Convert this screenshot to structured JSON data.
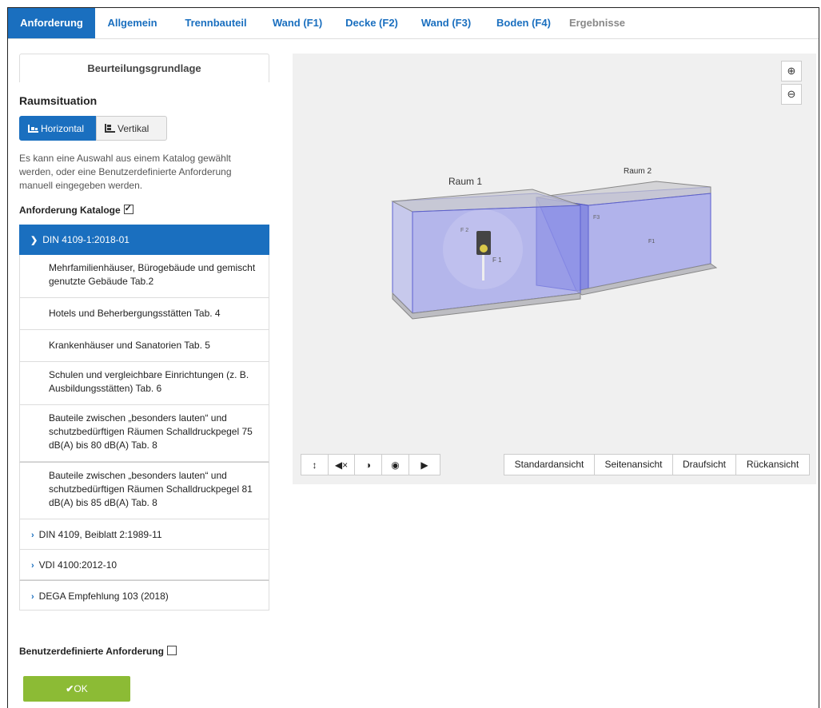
{
  "tabs": [
    {
      "label": "Anforderung"
    },
    {
      "label": "Allgemein"
    },
    {
      "label": "Trennbauteil"
    },
    {
      "label": "Wand (F1)"
    },
    {
      "label": "Decke (F2)"
    },
    {
      "label": "Wand (F3)"
    },
    {
      "label": "Boden (F4)"
    },
    {
      "label": "Ergebnisse"
    }
  ],
  "panel": {
    "title": "Beurteilungsgrundlage",
    "raumsituation": "Raumsituation",
    "toggle_horizontal": "Horizontal",
    "toggle_vertikal": "Vertikal",
    "description": "Es kann eine Auswahl aus einem Katalog gewählt werden, oder eine Benutzerdefinierte Anforderung manuell eingegeben werden.",
    "kataloge_label": "Anforderung Kataloge",
    "kataloge_checked": true,
    "accordion_open": "DIN 4109-1:2018-01",
    "items": [
      {
        "label": "Mehrfamilienhäuser, Bürogebäude und gemischt genutzte Gebäude Tab.2"
      },
      {
        "label": "Hotels und Beherbergungsstätten Tab. 4"
      },
      {
        "label": "Krankenhäuser und Sanatorien Tab. 5"
      },
      {
        "label": "Schulen und vergleichbare Einrichtungen (z. B. Ausbildungsstätten) Tab. 6"
      },
      {
        "label": "Bauteile zwischen „besonders lauten“ und schutzbedürftigen Räumen Schalldruckpegel 75 dB(A) bis 80 dB(A) Tab. 8"
      },
      {
        "label": "Bauteile zwischen „besonders lauten“ und schutzbedürftigen Räumen Schalldruckpegel 81 dB(A) bis 85 dB(A) Tab. 8"
      }
    ],
    "collapsed": [
      {
        "label": "DIN 4109, Beiblatt 2:1989-11"
      },
      {
        "label": "VDI 4100:2012-10"
      },
      {
        "label": "DEGA Empfehlung 103 (2018)"
      }
    ],
    "benutzer_label": "Benutzerdefinierte Anforderung",
    "benutzer_checked": false,
    "ok_label": "OK"
  },
  "viewer": {
    "room1_label": "Raum 1",
    "room2_label": "Raum 2",
    "face_labels": {
      "f1_left": "F 1",
      "f1_right": "F1",
      "f3": "F3",
      "f2": "F 2"
    },
    "tools": [
      "height-icon",
      "mute-icon",
      "contrast-icon",
      "camera-icon",
      "play-icon"
    ],
    "view_buttons": [
      "Standardansicht",
      "Seitenansicht",
      "Draufsicht",
      "Rückansicht"
    ]
  },
  "colors": {
    "accent": "#1a6fbf",
    "ok": "#8cbb35",
    "room_fill": "#6b6fd9"
  }
}
